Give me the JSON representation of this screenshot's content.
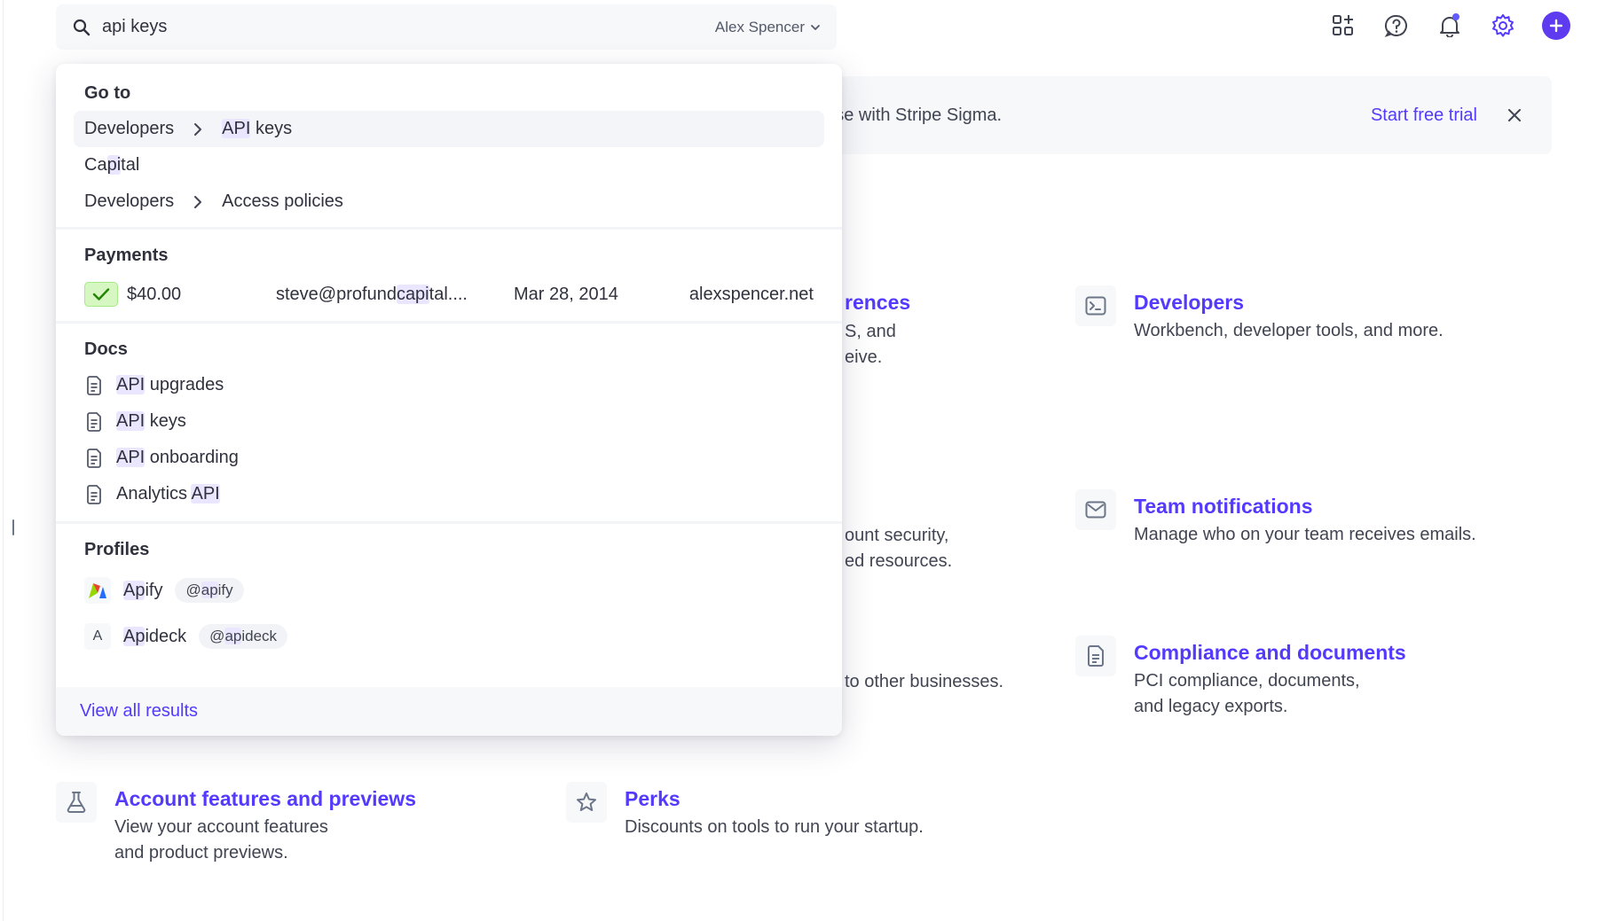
{
  "search": {
    "query": "api keys",
    "account_name": "Alex Spencer"
  },
  "banner": {
    "text": "base with Stripe Sigma.",
    "cta": "Start free trial"
  },
  "cards": [
    {
      "title": "Developers",
      "desc": [
        "Workbench, developer tools, and more."
      ],
      "icon": "terminal-icon"
    },
    {
      "title": "Team notifications",
      "desc": [
        "Manage who on your team receives emails."
      ],
      "icon": "mail-icon"
    },
    {
      "title": "Compliance and documents",
      "desc": [
        "PCI compliance, documents,",
        "and legacy exports."
      ],
      "icon": "document-icon"
    },
    {
      "title": "Account features and previews",
      "desc": [
        "View your account features",
        "and product previews."
      ],
      "icon": "flask-icon"
    },
    {
      "title": "Perks",
      "desc": [
        "Discounts on tools to run your startup."
      ],
      "icon": "star-icon"
    }
  ],
  "partial_cards": {
    "title_tail": "rences",
    "desc_a": [
      "S, and",
      "eive."
    ],
    "desc_b": [
      "ount security,",
      "ed resources."
    ],
    "desc_c": "to other businesses."
  },
  "dropdown": {
    "goto": {
      "heading": "Go to",
      "items": [
        {
          "parts": [
            "Developers",
            "API keys"
          ]
        },
        {
          "label": "Capital"
        },
        {
          "parts": [
            "Developers",
            "Access policies"
          ]
        }
      ]
    },
    "payments": {
      "heading": "Payments",
      "rows": [
        {
          "amount": "$40.00",
          "email_pre": "steve@profund",
          "email_hl": "capi",
          "email_post": "tal....",
          "date": "Mar 28, 2014",
          "site": "alexspencer.net",
          "status": "succeeded"
        }
      ]
    },
    "docs": {
      "heading": "Docs",
      "items": [
        {
          "hl": "API",
          "rest": " upgrades"
        },
        {
          "hl": "API",
          "rest": " keys"
        },
        {
          "hl": "API",
          "rest": " onboarding"
        },
        {
          "pre": "Analytics ",
          "hl": "API"
        }
      ]
    },
    "profiles": {
      "heading": "Profiles",
      "items": [
        {
          "name_hl": "Ap",
          "name_rest": "ify",
          "handle_pre": "@",
          "handle_hl": "ap",
          "handle_rest": "ify",
          "logo": "apify-logo"
        },
        {
          "name_hl": "Ap",
          "name_rest": "ideck",
          "handle_pre": "@",
          "handle_hl": "ap",
          "handle_rest": "ideck",
          "logo_letter": "A"
        }
      ]
    },
    "footer": "View all results"
  },
  "colors": {
    "accent": "#533afd",
    "highlight": "#ebe6ff",
    "success_bg": "#d7f7c2",
    "success_icon": "#228403"
  }
}
